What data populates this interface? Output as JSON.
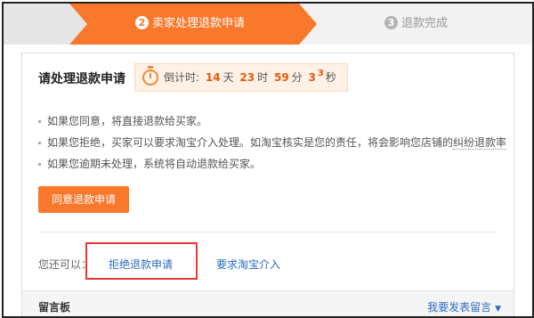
{
  "steps": [
    {
      "num": "2",
      "label": "卖家处理退款申请",
      "state": "active"
    },
    {
      "num": "3",
      "label": "退款完成",
      "state": "pending"
    }
  ],
  "panel": {
    "title": "请处理退款申请",
    "countdown": {
      "label": "倒计时:",
      "days": "14",
      "days_unit": "天",
      "hours": "23",
      "hours_unit": "时",
      "minutes": "59",
      "minutes_unit": "分",
      "seconds": "3",
      "seconds_sup": "3",
      "seconds_unit": "秒"
    },
    "tips": [
      "如果您同意，将直接退款给买家。",
      "如果您拒绝，买家可以要求淘宝介入处理。如淘宝核实是您的责任，将会影响您店铺的",
      "如果您逾期未处理，系统将自动退款给买家。"
    ],
    "tip_link": "纠纷退款率",
    "agree_button": "同意退款申请",
    "more_label": "您还可以：",
    "reject_link": "拒绝退款申请",
    "taobao_link": "要求淘宝介入"
  },
  "message_board": {
    "title": "留言板",
    "post_link": "我要发表留言"
  },
  "colors": {
    "accent": "#f9782b",
    "link": "#2a6cbf",
    "highlight_box": "#e53935"
  }
}
